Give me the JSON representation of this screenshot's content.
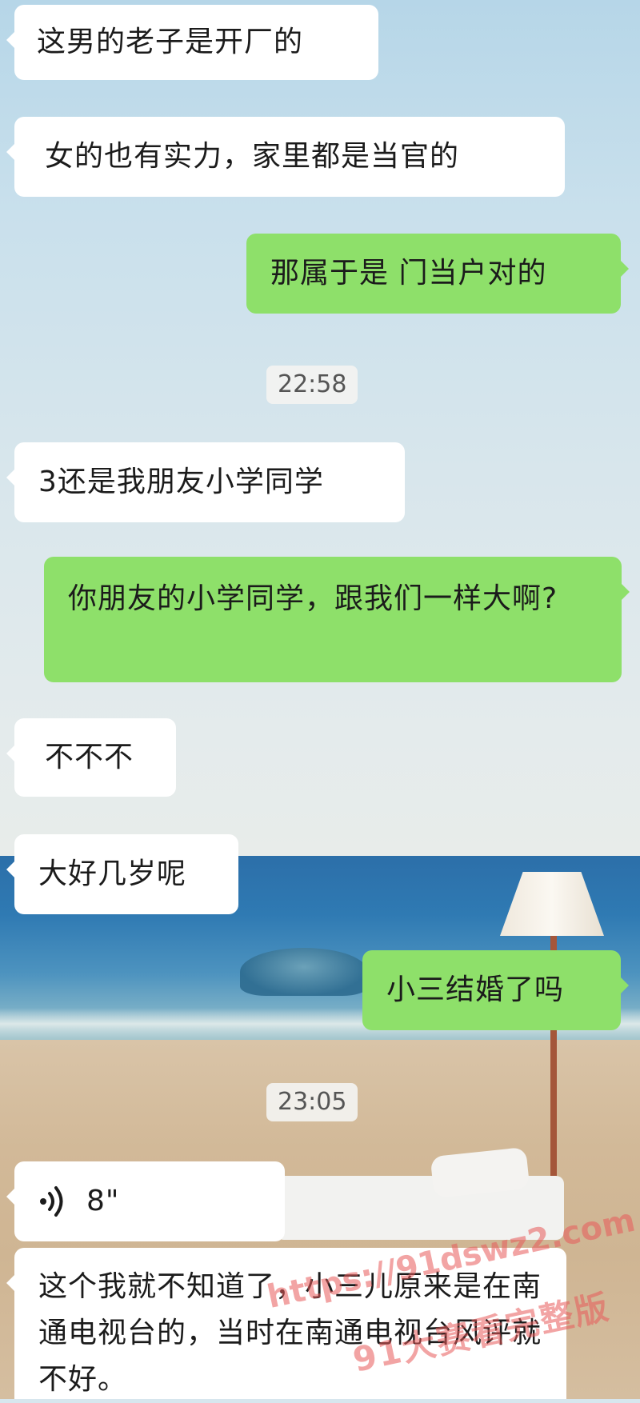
{
  "colors": {
    "incoming_bubble": "#ffffff",
    "outgoing_bubble": "#8ee06a",
    "watermark": "#e85a5a"
  },
  "messages": [
    {
      "side": "in",
      "text": "这男的老子是开厂的"
    },
    {
      "side": "in",
      "text": "女的也有实力，家里都是当官的"
    },
    {
      "side": "out",
      "text": "那属于是 门当户对的"
    },
    {
      "side": "in",
      "text": "3还是我朋友小学同学"
    },
    {
      "side": "out",
      "text": "你朋友的小学同学，跟我们一样大啊?"
    },
    {
      "side": "in",
      "text": "不不不"
    },
    {
      "side": "in",
      "text": "大好几岁呢"
    },
    {
      "side": "out",
      "text": "小三结婚了吗"
    },
    {
      "side": "in",
      "type": "voice",
      "icon": "voice-wave-icon",
      "duration": "8\""
    },
    {
      "side": "in",
      "text": "这个我就不知道了，小三儿原来是在南通电视台的，当时在南通电视台风评就不好。"
    }
  ],
  "timestamps": [
    "22:58",
    "23:05"
  ],
  "watermark": {
    "url": "https://91dswz2.com",
    "text": "91大赛看完整版"
  }
}
